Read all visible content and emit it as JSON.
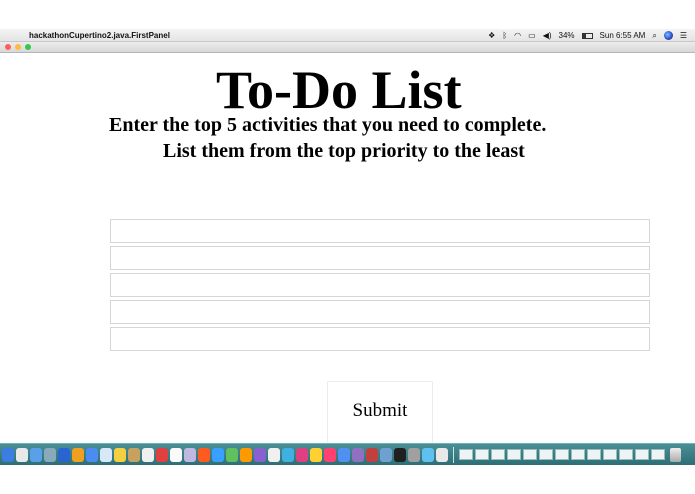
{
  "menubar": {
    "apple_glyph": "",
    "app_name": "hackathonCupertino2.java.FirstPanel",
    "battery": "34%",
    "clock": "Sun 6:55 AM"
  },
  "main": {
    "title": "To-Do List",
    "subtitle_line1": "Enter the top 5 activities that you need to complete.",
    "subtitle_line2": "List them from the top priority to the least",
    "tasks": [
      {
        "value": "",
        "placeholder": ""
      },
      {
        "value": "",
        "placeholder": ""
      },
      {
        "value": "",
        "placeholder": ""
      },
      {
        "value": "",
        "placeholder": ""
      },
      {
        "value": "",
        "placeholder": ""
      }
    ],
    "submit_label": "Submit"
  },
  "window_controls": {
    "close_color": "#fc605c",
    "minimize_color": "#fdbc40",
    "maximize_color": "#34c84a"
  },
  "dock": {
    "background_color": "#3f8088",
    "app_icon_colors": [
      "#3b7de0",
      "#e8e8e8",
      "#5aa0e8",
      "#8ab",
      "#2a64d0",
      "#f0a020",
      "#4c8cf0",
      "#d8e8f8",
      "#f4d040",
      "#c8a060",
      "#f0f0f0",
      "#e04040",
      "#fafafa",
      "#bfb8e0",
      "#ff5a1f",
      "#3aa0ff",
      "#60c060",
      "#ff9900",
      "#8a60d0",
      "#f0f0f0",
      "#40b0e0",
      "#e04080",
      "#ffd030",
      "#ff4070",
      "#5090f0",
      "#9070c0",
      "#c04040",
      "#70a0d0",
      "#202020",
      "#a0a0a0",
      "#60c0f0",
      "#e8e8e8"
    ],
    "window_thumbnail_count": 13
  }
}
